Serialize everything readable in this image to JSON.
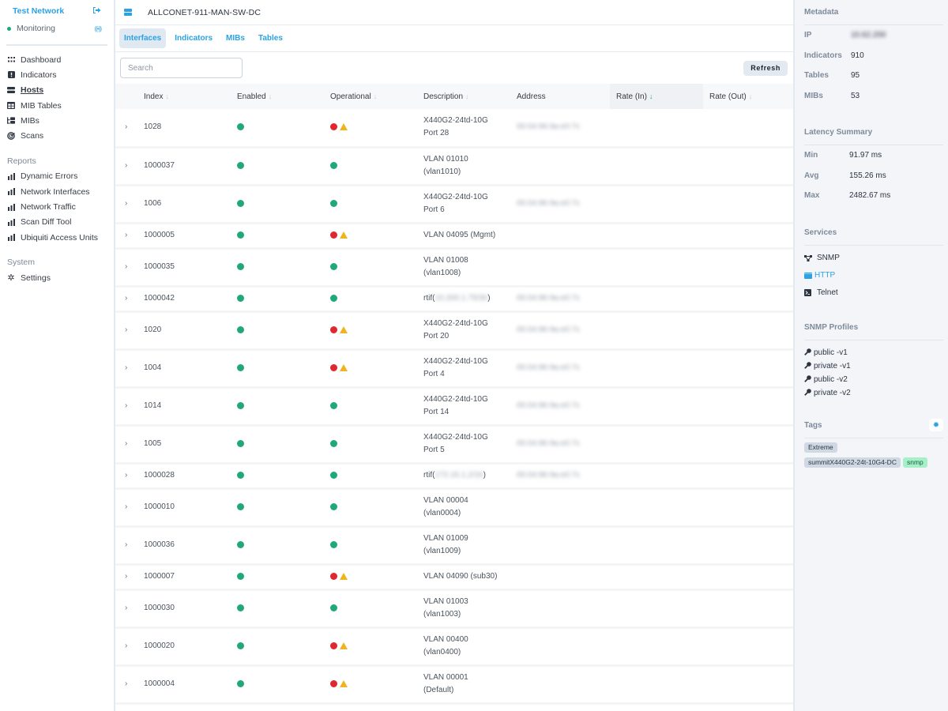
{
  "sidebar": {
    "title": "Test Network",
    "status": "Monitoring",
    "nav": [
      {
        "label": "Dashboard",
        "icon": "grid-icon",
        "active": false
      },
      {
        "label": "Indicators",
        "icon": "alert-square-icon",
        "active": false
      },
      {
        "label": "Hosts",
        "icon": "server-icon",
        "active": true
      },
      {
        "label": "MIB Tables",
        "icon": "table-icon",
        "active": false
      },
      {
        "label": "MIBs",
        "icon": "tree-icon",
        "active": false
      },
      {
        "label": "Scans",
        "icon": "radar-icon",
        "active": false
      }
    ],
    "reports_label": "Reports",
    "reports": [
      {
        "label": "Dynamic Errors",
        "icon": "bar-chart-icon"
      },
      {
        "label": "Network Interfaces",
        "icon": "bar-chart-icon"
      },
      {
        "label": "Network Traffic",
        "icon": "bar-chart-icon"
      },
      {
        "label": "Scan Diff Tool",
        "icon": "bar-chart-icon"
      },
      {
        "label": "Ubiquiti Access Units",
        "icon": "bar-chart-icon"
      }
    ],
    "system_label": "System",
    "system": [
      {
        "label": "Settings",
        "icon": "gear-icon"
      }
    ]
  },
  "header": {
    "host_name": "ALLCONET-911-MAN-SW-DC"
  },
  "tabs": [
    {
      "label": "Interfaces",
      "active": true
    },
    {
      "label": "Indicators",
      "active": false
    },
    {
      "label": "MIBs",
      "active": false
    },
    {
      "label": "Tables",
      "active": false
    }
  ],
  "toolbar": {
    "search_placeholder": "Search",
    "search_value": "",
    "refresh_label": "Refresh"
  },
  "table": {
    "columns": [
      {
        "label": "Index",
        "sortable": true,
        "sorted": false
      },
      {
        "label": "Enabled",
        "sortable": true,
        "sorted": false
      },
      {
        "label": "Operational",
        "sortable": true,
        "sorted": false
      },
      {
        "label": "Description",
        "sortable": true,
        "sorted": false
      },
      {
        "label": "Address",
        "sortable": false,
        "sorted": false
      },
      {
        "label": "Rate (In)",
        "sortable": true,
        "sorted": true
      },
      {
        "label": "Rate (Out)",
        "sortable": true,
        "sorted": false
      }
    ],
    "sort_arrow": "↓",
    "rows": [
      {
        "index": "1028",
        "enabled": "up",
        "operational": "down",
        "warning": true,
        "description": "X440G2-24td-10G\nPort 28",
        "address": "00:04:96:9a:e0:7c",
        "address_redacted": true,
        "rate_in": "",
        "rate_out": ""
      },
      {
        "index": "1000037",
        "enabled": "up",
        "operational": "up",
        "warning": false,
        "description": "VLAN 01010\n(vlan1010)",
        "address": "",
        "address_redacted": false,
        "rate_in": "",
        "rate_out": ""
      },
      {
        "index": "1006",
        "enabled": "up",
        "operational": "up",
        "warning": false,
        "description": "X440G2-24td-10G\nPort 6",
        "address": "00:04:96:9a:e0:7c",
        "address_redacted": true,
        "rate_in": "",
        "rate_out": ""
      },
      {
        "index": "1000005",
        "enabled": "up",
        "operational": "down",
        "warning": true,
        "description": "VLAN 04095 (Mgmt)",
        "address": "",
        "address_redacted": false,
        "rate_in": "",
        "rate_out": ""
      },
      {
        "index": "1000035",
        "enabled": "up",
        "operational": "up",
        "warning": false,
        "description": "VLAN 01008\n(vlan1008)",
        "address": "",
        "address_redacted": false,
        "rate_in": "",
        "rate_out": ""
      },
      {
        "index": "1000042",
        "enabled": "up",
        "operational": "up",
        "warning": false,
        "description_prefix": "rtif(",
        "description_redacted": "10.200.1.75/30",
        "description_suffix": ")",
        "address": "00:04:96:9a:e0:7c",
        "address_redacted": true,
        "rate_in": "",
        "rate_out": ""
      },
      {
        "index": "1020",
        "enabled": "up",
        "operational": "down",
        "warning": true,
        "description": "X440G2-24td-10G\nPort 20",
        "address": "00:04:96:9a:e0:7c",
        "address_redacted": true,
        "rate_in": "",
        "rate_out": ""
      },
      {
        "index": "1004",
        "enabled": "up",
        "operational": "down",
        "warning": true,
        "description": "X440G2-24td-10G\nPort 4",
        "address": "00:04:96:9a:e0:7c",
        "address_redacted": true,
        "rate_in": "",
        "rate_out": ""
      },
      {
        "index": "1014",
        "enabled": "up",
        "operational": "up",
        "warning": false,
        "description": "X440G2-24td-10G\nPort 14",
        "address": "00:04:96:9a:e0:7c",
        "address_redacted": true,
        "rate_in": "",
        "rate_out": ""
      },
      {
        "index": "1005",
        "enabled": "up",
        "operational": "up",
        "warning": false,
        "description": "X440G2-24td-10G\nPort 5",
        "address": "00:04:96:9a:e0:7c",
        "address_redacted": true,
        "rate_in": "",
        "rate_out": ""
      },
      {
        "index": "1000028",
        "enabled": "up",
        "operational": "up",
        "warning": false,
        "description_prefix": "rtif(",
        "description_redacted": "172.16.1.2/16",
        "description_suffix": ")",
        "address": "00:04:96:9a:e0:7c",
        "address_redacted": true,
        "rate_in": "",
        "rate_out": ""
      },
      {
        "index": "1000010",
        "enabled": "up",
        "operational": "up",
        "warning": false,
        "description": "VLAN 00004\n(vlan0004)",
        "address": "",
        "address_redacted": false,
        "rate_in": "",
        "rate_out": ""
      },
      {
        "index": "1000036",
        "enabled": "up",
        "operational": "up",
        "warning": false,
        "description": "VLAN 01009\n(vlan1009)",
        "address": "",
        "address_redacted": false,
        "rate_in": "",
        "rate_out": ""
      },
      {
        "index": "1000007",
        "enabled": "up",
        "operational": "down",
        "warning": true,
        "description": "VLAN 04090 (sub30)",
        "address": "",
        "address_redacted": false,
        "rate_in": "",
        "rate_out": ""
      },
      {
        "index": "1000030",
        "enabled": "up",
        "operational": "up",
        "warning": false,
        "description": "VLAN 01003\n(vlan1003)",
        "address": "",
        "address_redacted": false,
        "rate_in": "",
        "rate_out": ""
      },
      {
        "index": "1000020",
        "enabled": "up",
        "operational": "down",
        "warning": true,
        "description": "VLAN 00400\n(vlan0400)",
        "address": "",
        "address_redacted": false,
        "rate_in": "",
        "rate_out": ""
      },
      {
        "index": "1000004",
        "enabled": "up",
        "operational": "down",
        "warning": true,
        "description": "VLAN 00001\n(Default)",
        "address": "",
        "address_redacted": false,
        "rate_in": "",
        "rate_out": ""
      }
    ]
  },
  "right_panel": {
    "metadata": {
      "title": "Metadata",
      "items": [
        {
          "key": "IP",
          "value": "10.62.200",
          "redacted": true
        },
        {
          "key": "Indicators",
          "value": "910",
          "redacted": false
        },
        {
          "key": "Tables",
          "value": "95",
          "redacted": false
        },
        {
          "key": "MIBs",
          "value": "53",
          "redacted": false
        }
      ]
    },
    "latency": {
      "title": "Latency Summary",
      "items": [
        {
          "key": "Min",
          "value": "91.97 ms"
        },
        {
          "key": "Avg",
          "value": "155.26 ms"
        },
        {
          "key": "Max",
          "value": "2482.67 ms"
        }
      ]
    },
    "services": {
      "title": "Services",
      "items": [
        {
          "label": "SNMP",
          "icon": "network-icon",
          "link": false
        },
        {
          "label": "HTTP",
          "icon": "browser-window-icon",
          "link": true
        },
        {
          "label": "Telnet",
          "icon": "terminal-icon",
          "link": false
        }
      ]
    },
    "snmp_profiles": {
      "title": "SNMP Profiles",
      "items": [
        "public -v1",
        "private -v1",
        "public -v2",
        "private -v2"
      ]
    },
    "tags": {
      "title": "Tags",
      "items": [
        {
          "label": "Extreme",
          "color": "#cfd8e3"
        },
        {
          "label": "summitX440G2-24t-10G4-DC",
          "color": "#cfd8e3"
        },
        {
          "label": "snmp",
          "color": "#a5efc9"
        }
      ]
    }
  },
  "colors": {
    "accent": "#2aa2e4",
    "status_up": "#1fa97b",
    "status_down": "#e0262f",
    "warning": "#f1b31c"
  }
}
